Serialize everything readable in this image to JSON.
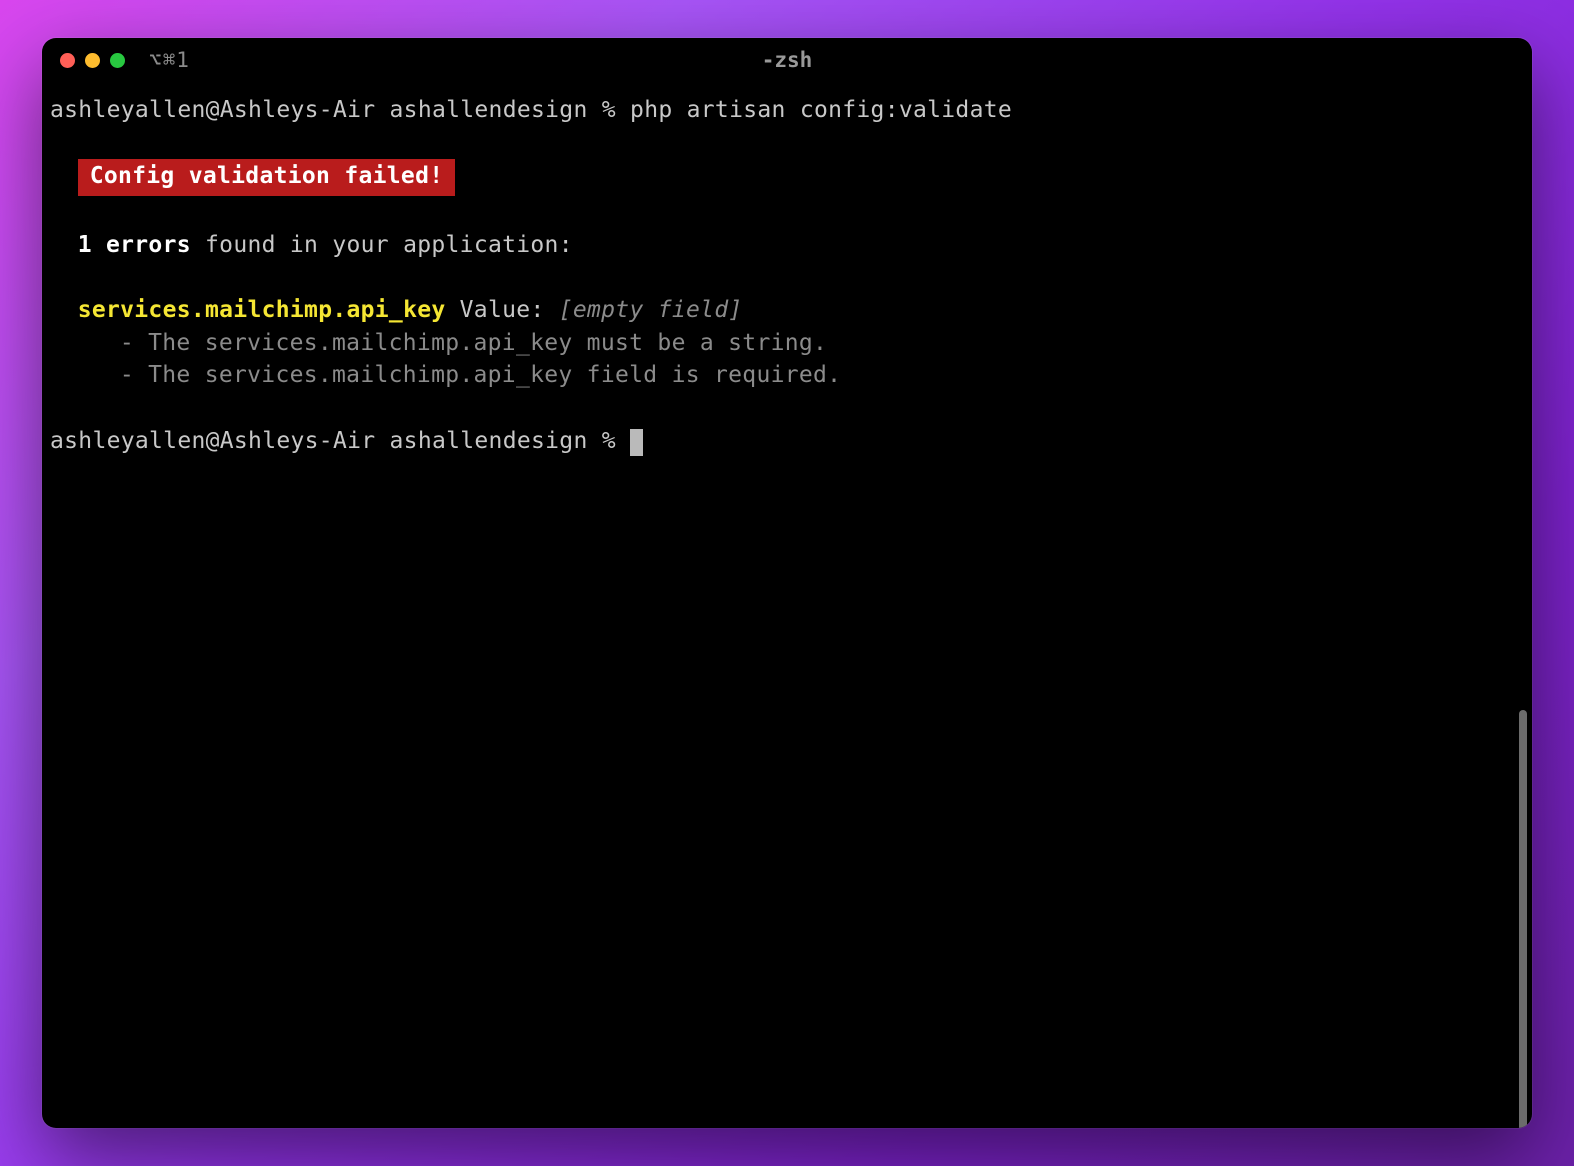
{
  "window": {
    "title": "-zsh",
    "tab_indicator": "⌥⌘1"
  },
  "terminal": {
    "prompt1": "ashleyallen@Ashleys-Air ashallendesign % ",
    "command": "php artisan config:validate",
    "error_banner": " Config validation failed! ",
    "error_count": "1 errors",
    "error_count_suffix": " found in your application:",
    "config_key": "services.mailchimp.api_key",
    "value_label": "  Value: ",
    "empty_field": "[empty field]",
    "details": [
      "  - The services.mailchimp.api_key must be a string.",
      "  - The services.mailchimp.api_key field is required."
    ],
    "prompt2": "ashleyallen@Ashleys-Air ashallendesign % "
  }
}
